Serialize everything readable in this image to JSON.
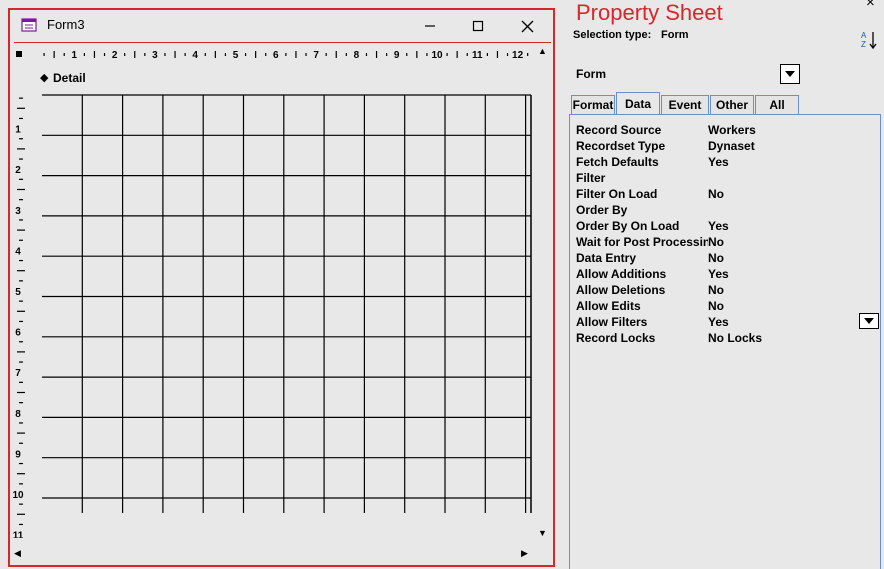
{
  "form_window": {
    "title": "Form3",
    "icon": "form-icon",
    "minimize_icon": "minimize-icon",
    "maximize_icon": "maximize-icon",
    "close_icon": "close-icon",
    "section_label": "Detail",
    "ruler_h_labels": [
      "1",
      "2",
      "3",
      "4",
      "5",
      "6",
      "7",
      "8",
      "9",
      "10",
      "11",
      "12"
    ],
    "ruler_v_labels": [
      "1",
      "2",
      "3",
      "4",
      "5",
      "6",
      "7",
      "8",
      "9",
      "10",
      "11"
    ]
  },
  "property_sheet": {
    "title": "Property Sheet",
    "close_glyph": "×",
    "selection_type_label": "Selection type:",
    "selection_type_value": "Form",
    "sort_icon": "sort-az-icon",
    "object_selector": "Form",
    "tabs": [
      {
        "label": "Format",
        "active": false
      },
      {
        "label": "Data",
        "active": true
      },
      {
        "label": "Event",
        "active": false
      },
      {
        "label": "Other",
        "active": false
      },
      {
        "label": "All",
        "active": false
      }
    ],
    "properties": [
      {
        "name": "Record Source",
        "value": "Workers"
      },
      {
        "name": "Recordset Type",
        "value": "Dynaset"
      },
      {
        "name": "Fetch Defaults",
        "value": "Yes"
      },
      {
        "name": "Filter",
        "value": ""
      },
      {
        "name": "Filter On Load",
        "value": "No"
      },
      {
        "name": "Order By",
        "value": ""
      },
      {
        "name": "Order By On Load",
        "value": "Yes"
      },
      {
        "name": "Wait for Post Processing",
        "value": "No"
      },
      {
        "name": "Data Entry",
        "value": "No"
      },
      {
        "name": "Allow Additions",
        "value": "Yes"
      },
      {
        "name": "Allow Deletions",
        "value": "No"
      },
      {
        "name": "Allow Edits",
        "value": "No"
      },
      {
        "name": "Allow Filters",
        "value": "Yes"
      },
      {
        "name": "Record Locks",
        "value": "No Locks"
      }
    ]
  }
}
